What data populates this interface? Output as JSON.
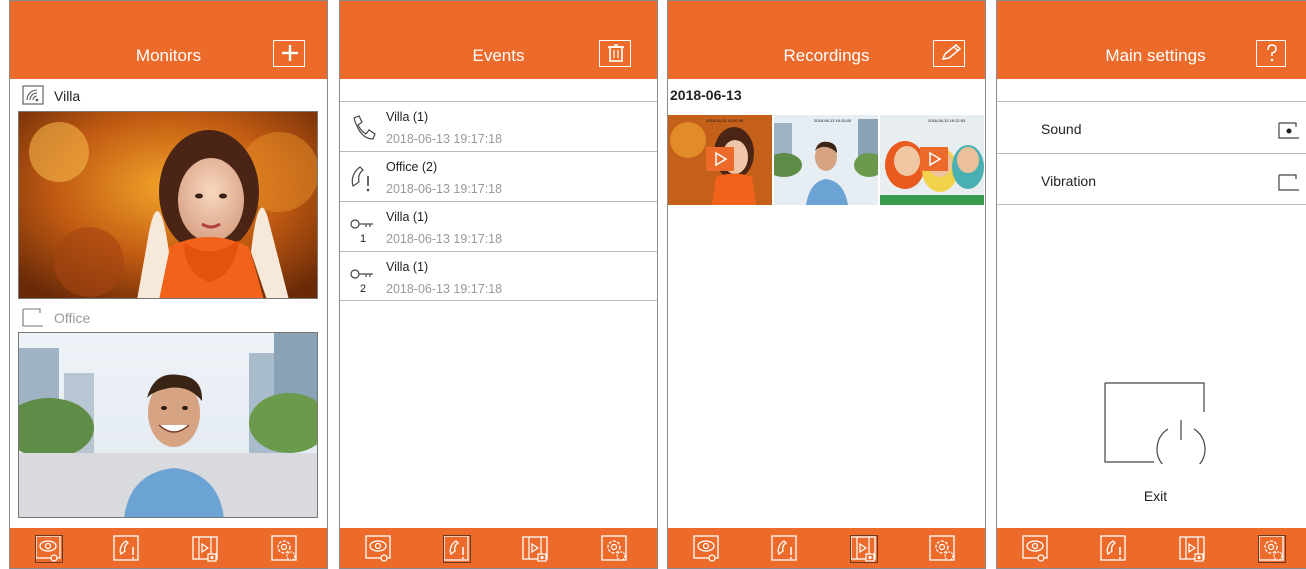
{
  "colors": {
    "accent": "#ec6a2a",
    "text": "#222222",
    "muted": "#999999"
  },
  "monitors_screen": {
    "title": "Monitors",
    "header_action": "add-icon",
    "monitors": [
      {
        "label": "Villa",
        "icon": "wifi-monitor-icon",
        "selected": true
      },
      {
        "label": "Office",
        "icon": "monitor-outline-icon",
        "selected": false
      }
    ]
  },
  "events_screen": {
    "title": "Events",
    "header_action": "trash-icon",
    "events": [
      {
        "title": "Villa (1)",
        "time": "2018-06-13 19:17:18",
        "icon": "handset-icon"
      },
      {
        "title": "Office (2)",
        "time": "2018-06-13 19:17:18",
        "icon": "missed-call-icon"
      },
      {
        "title": "Villa (1)",
        "time": "2018-06-13 19:17:18",
        "icon": "key-icon",
        "key_number": "1"
      },
      {
        "title": "Villa (1)",
        "time": "2018-06-13 19:17:18",
        "icon": "key-icon",
        "key_number": "2"
      }
    ]
  },
  "recordings_screen": {
    "title": "Recordings",
    "header_action": "edit-icon",
    "date": "2018-06-13",
    "thumbnails": [
      {
        "stamp": "2018-06-13 19:20:09",
        "is_video": true
      },
      {
        "stamp": "2018-06-13 19:15:00",
        "is_video": false
      },
      {
        "stamp": "2018-06-13 19:12:53",
        "is_video": true
      }
    ]
  },
  "settings_screen": {
    "title": "Main settings",
    "header_action": "help-icon",
    "options": [
      {
        "label": "Sound",
        "checked": true
      },
      {
        "label": "Vibration",
        "checked": false
      }
    ],
    "exit_label": "Exit"
  },
  "footer_icons": [
    "monitor-eye-icon",
    "call-log-icon",
    "recordings-icon",
    "settings-gear-icon"
  ]
}
